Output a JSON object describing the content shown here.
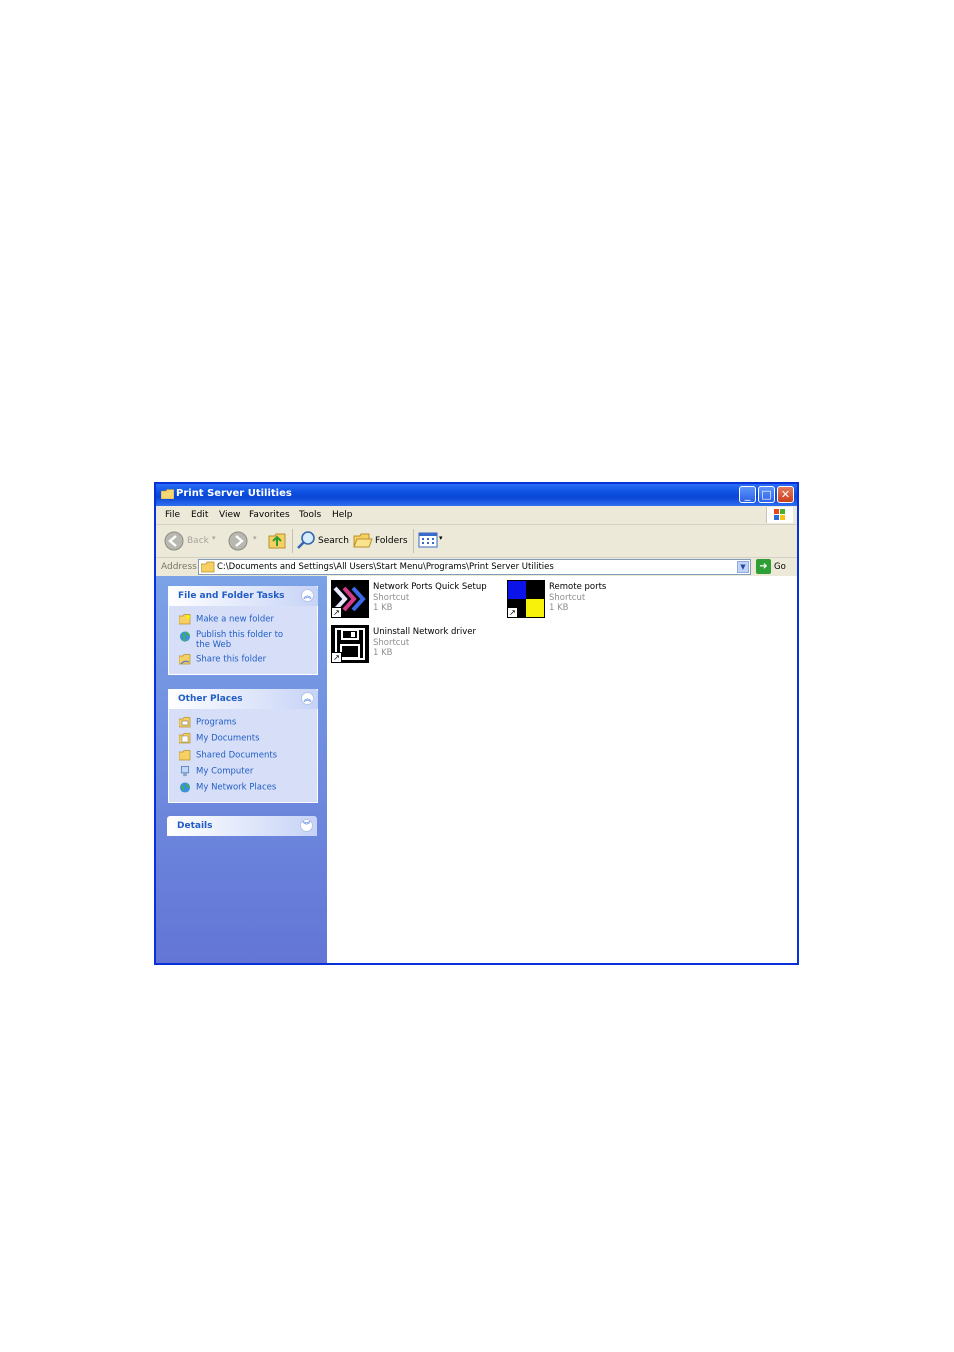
{
  "window": {
    "title": "Print Server Utilities",
    "controls": {
      "minimize": "_",
      "maximize": "□",
      "close": "✕"
    }
  },
  "menu": {
    "items": [
      "File",
      "Edit",
      "View",
      "Favorites",
      "Tools",
      "Help"
    ]
  },
  "toolbar": {
    "back_label": "Back",
    "search_label": "Search",
    "folders_label": "Folders"
  },
  "address": {
    "label": "Address",
    "value": "C:\\Documents and Settings\\All Users\\Start Menu\\Programs\\Print Server Utilities",
    "go_label": "Go"
  },
  "tasks_panel": {
    "title": "File and Folder Tasks",
    "items": [
      {
        "label": "Make a new folder",
        "icon": "new-folder-icon"
      },
      {
        "label": "Publish this folder to the Web",
        "icon": "publish-web-icon"
      },
      {
        "label": "Share this folder",
        "icon": "share-folder-icon"
      }
    ]
  },
  "other_places": {
    "title": "Other Places",
    "items": [
      {
        "label": "Programs",
        "icon": "programs-folder-icon"
      },
      {
        "label": "My Documents",
        "icon": "my-documents-icon"
      },
      {
        "label": "Shared Documents",
        "icon": "shared-documents-icon"
      },
      {
        "label": "My Computer",
        "icon": "my-computer-icon"
      },
      {
        "label": "My Network Places",
        "icon": "my-network-places-icon"
      }
    ]
  },
  "details_panel": {
    "title": "Details"
  },
  "files": [
    {
      "name": "Network Ports Quick Setup",
      "type": "Shortcut",
      "size": "1 KB",
      "icon": "network-ports-icon"
    },
    {
      "name": "Remote ports",
      "type": "Shortcut",
      "size": "1 KB",
      "icon": "remote-ports-icon"
    },
    {
      "name": "Uninstall Network driver",
      "type": "Shortcut",
      "size": "1 KB",
      "icon": "uninstall-driver-icon"
    }
  ],
  "colors": {
    "titlebar": "#0c4fe0",
    "task_link": "#215dc6",
    "left_pane": "#7ba2e7"
  }
}
